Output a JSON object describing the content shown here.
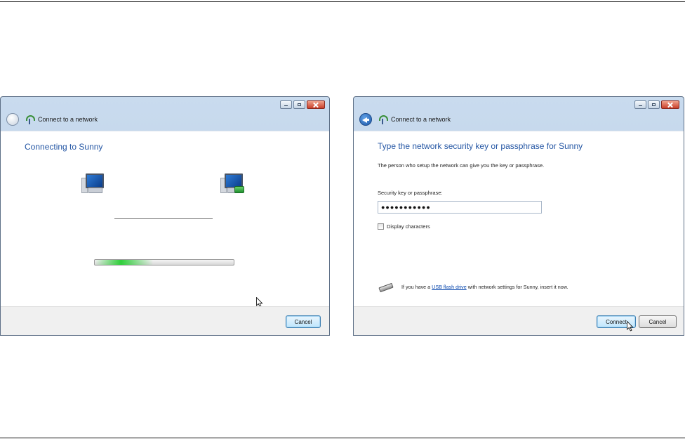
{
  "window_left": {
    "title": "Connect to a network",
    "heading": "Connecting to Sunny",
    "progress_percent": 30,
    "cancel_label": "Cancel"
  },
  "window_right": {
    "title": "Connect to a network",
    "heading": "Type the network security key or passphrase for Sunny",
    "description": "The person who setup the network can give you the key or passphrase.",
    "key_label": "Security key or passphrase:",
    "key_value": "●●●●●●●●●●●",
    "display_characters_label": "Display characters",
    "display_characters_checked": false,
    "usb_text_before": "If you have a ",
    "usb_link": "USB flash drive",
    "usb_text_after": " with network settings for Sunny, insert it now.",
    "connect_label": "Connect",
    "cancel_label": "Cancel"
  },
  "colors": {
    "heading": "#2456a4",
    "progress": "#2fcf3a",
    "link": "#0645ad"
  }
}
